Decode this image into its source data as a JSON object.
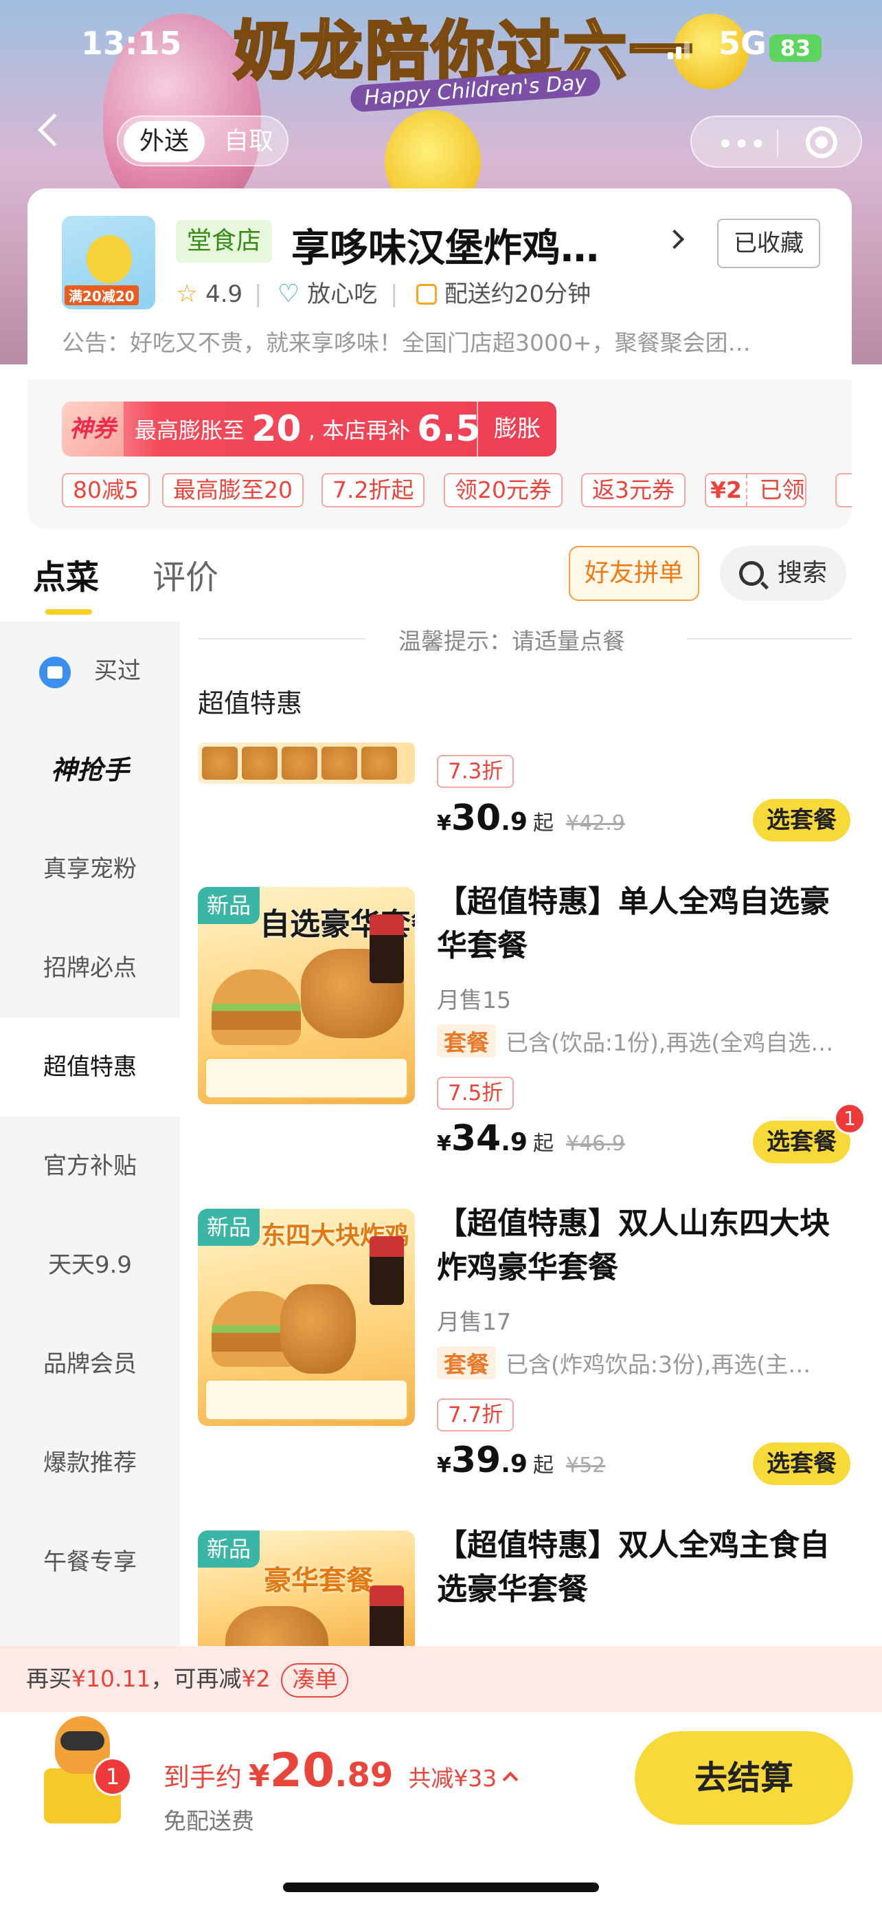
{
  "status_bar": {
    "time": "13:15",
    "network": "5G",
    "battery": "83"
  },
  "banner": {
    "headline": "奶龙陪你过六一",
    "subtitle": "Happy Children's Day"
  },
  "nav": {
    "tabs": [
      "外送",
      "自取"
    ],
    "active_tab": "外送",
    "capsule_more": "•••"
  },
  "shop": {
    "logo_promo": "满20减20",
    "tag": "堂食店",
    "name": "享哆味汉堡炸鸡…",
    "favorite_label": "已收藏",
    "rating": "4.9",
    "safe_label": "放心吃",
    "delivery_label": "配送约20分钟",
    "notice": "公告：好吃又不贵，就来享哆味！全国门店超3000+，聚餐聚会团…"
  },
  "coupon_banner": {
    "tag": "神券",
    "text_a": "最高膨胀至",
    "num_a": "20",
    "text_b": ", 本店再补",
    "num_b": "6.5",
    "button": "膨胀"
  },
  "coupon_chips": [
    "80减5",
    "最高膨至20",
    "7.2折起",
    "领20元券",
    "返3元券"
  ],
  "claimed_coupon": {
    "amount": "¥2",
    "label": "已领"
  },
  "tabs_row": {
    "tabs": [
      "点菜",
      "评价"
    ],
    "active": "点菜",
    "group_order": "好友拼单",
    "search_label": "搜索"
  },
  "sidebar": {
    "items": [
      {
        "label": "买过",
        "icon": "bag-icon"
      },
      {
        "label": "神抢手"
      },
      {
        "label": "真享宠粉"
      },
      {
        "label": "招牌必点"
      },
      {
        "label": "超值特惠"
      },
      {
        "label": "官方补贴"
      },
      {
        "label": "天天9.9"
      },
      {
        "label": "品牌会员"
      },
      {
        "label": "爆款推荐"
      },
      {
        "label": "午餐专享"
      }
    ],
    "active": "超值特惠"
  },
  "menu": {
    "tip": "温馨提示：请适量点餐",
    "category": "超值特惠",
    "products": [
      {
        "new": "",
        "image_caption": "",
        "name": "",
        "sales": "",
        "set_tag": "",
        "set_desc": "",
        "discount": "7.3折",
        "price_int": "30",
        "price_dec": ".9",
        "price_suffix": "起",
        "orig_price": "¥42.9",
        "button": "选套餐"
      },
      {
        "new": "新品",
        "image_caption": "自选豪华套餐",
        "name": "【超值特惠】单人全鸡自选豪华套餐",
        "sales": "月售15",
        "set_tag": "套餐",
        "set_desc": "已含(饮品:1份),再选(全鸡自选…",
        "discount": "7.5折",
        "price_int": "34",
        "price_dec": ".9",
        "price_suffix": "起",
        "orig_price": "¥46.9",
        "button": "选套餐",
        "badge": "1"
      },
      {
        "new": "新品",
        "image_caption": "东四大块炸鸡",
        "name": "【超值特惠】双人山东四大块炸鸡豪华套餐",
        "sales": "月售17",
        "set_tag": "套餐",
        "set_desc": "已含(炸鸡饮品:3份),再选(主…",
        "discount": "7.7折",
        "price_int": "39",
        "price_dec": ".9",
        "price_suffix": "起",
        "orig_price": "¥52",
        "button": "选套餐"
      },
      {
        "new": "新品",
        "image_caption": "豪华套餐",
        "name": "【超值特惠】双人全鸡主食自选豪华套餐"
      }
    ]
  },
  "rebuy_bar": {
    "text_a": "再买",
    "amount_a": "¥10.11",
    "text_b": "，可再减",
    "amount_b": "¥2",
    "button": "凑单"
  },
  "cart": {
    "count": "1",
    "label": "到手约",
    "currency": "¥",
    "total_int": "20",
    "total_dec": ".89",
    "saved": "共减¥33",
    "delivery_fee": "免配送费",
    "checkout": "去结算"
  }
}
